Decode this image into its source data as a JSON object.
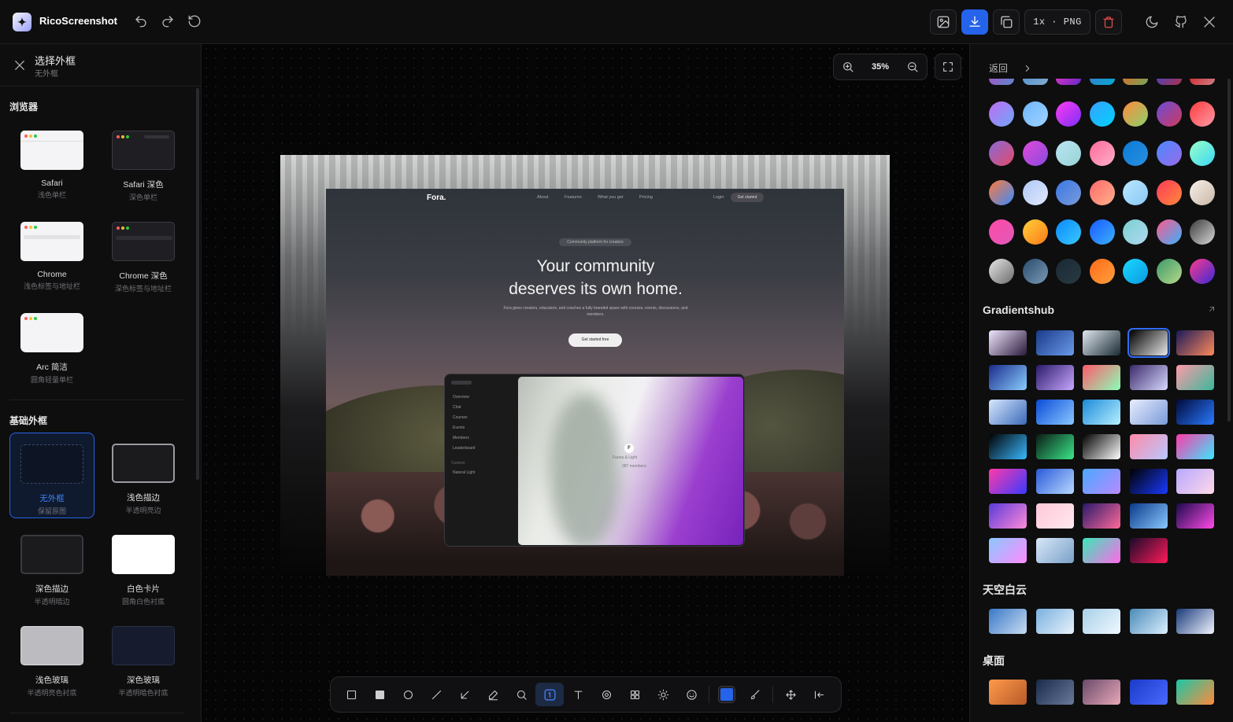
{
  "app": {
    "name": "RicoScreenshot",
    "format_label": "1x · PNG"
  },
  "colors": {
    "accent": "#2563eb",
    "danger": "#e04b4b",
    "background": "#0b0b0c"
  },
  "topbar": {
    "left_icons": [
      "undo-icon",
      "redo-icon",
      "reset-icon"
    ],
    "right_icons": [
      "image-icon",
      "download-icon",
      "copy-icon",
      "trash-icon",
      "moon-icon",
      "github-icon",
      "x-icon"
    ]
  },
  "left_panel": {
    "title": "选择外框",
    "subtitle": "无外框",
    "sections": [
      {
        "title": "浏览器",
        "items": [
          {
            "name": "Safari",
            "sub": "浅色单栏"
          },
          {
            "name": "Safari 深色",
            "sub": "深色单栏"
          },
          {
            "name": "Chrome",
            "sub": "浅色标签与地址栏"
          },
          {
            "name": "Chrome 深色",
            "sub": "深色标签与地址栏"
          },
          {
            "name": "Arc 简洁",
            "sub": "圆角轻量单栏"
          }
        ]
      },
      {
        "title": "基础外框",
        "items": [
          {
            "name": "无外框",
            "sub": "保留原图",
            "selected": true
          },
          {
            "name": "浅色描边",
            "sub": "半透明亮边"
          },
          {
            "name": "深色描边",
            "sub": "半透明暗边"
          },
          {
            "name": "白色卡片",
            "sub": "圆角白色衬底"
          },
          {
            "name": "浅色玻璃",
            "sub": "半透明亮色衬底"
          },
          {
            "name": "深色玻璃",
            "sub": "半透明暗色衬底"
          }
        ]
      }
    ]
  },
  "canvas": {
    "zoom": "35%",
    "preview": {
      "brand": "Fora.",
      "nav": [
        "About",
        "Features",
        "What you get",
        "Pricing"
      ],
      "login": "Login",
      "get_started": "Get started",
      "pill": "Community platform for creators",
      "headline_1": "Your community",
      "headline_2": "deserves its own home.",
      "subtext": "Fora gives creators, educators, and coaches a fully branded space with courses, events, discussions, and members.",
      "cta": "Get started free",
      "sidebar": [
        "Overview",
        "Chat",
        "Courses",
        "Events",
        "Members",
        "Leaderboard"
      ],
      "sidebar_section": "Content",
      "sidebar_extra": "Natural Light",
      "badge": "F",
      "card_title": "Fauna & Light",
      "card_meta": "387 members"
    }
  },
  "toolbar": {
    "tools": [
      "rect-outline-icon",
      "rect-filled-icon",
      "circle-icon",
      "line-icon",
      "arrow-icon",
      "pen-icon",
      "magnifier-icon",
      "number-icon",
      "text-icon",
      "blur-icon",
      "mosaic-icon",
      "brightness-icon",
      "emoji-icon"
    ],
    "active_tool": "number-icon",
    "current_color": "#2563eb"
  },
  "right_panel": {
    "back_label": "返回",
    "sections": {
      "gradientshub": "Gradientshub",
      "sky": "天空白云",
      "desktop": "桌面"
    },
    "swatches": [
      [
        "#c06cf3,#6fa8f7",
        "#6fb6ff,#9fd3ff",
        "#ff3cf2,#7b2ff7",
        "#3aa0ff,#00d2ff",
        "#ff8a3c,#8bd06a",
        "#6a4cd8,#d03a5c",
        "#ff3c3c,#ff9aa8"
      ],
      [
        "#8a6ad8,#e24a6a",
        "#e04ad8,#8a4ae0",
        "#b8e4f4,#9ad4d4",
        "#ff6a9a,#ffb0c8",
        "#0a7ad8,#2a90e0",
        "#4a8aff,#9a6ae8",
        "#9affc8,#3ad8f4"
      ],
      [
        "#ff7a3a,#3a8aff",
        "#b0c8f4,#e0e8ff",
        "#3a78e8,#7a9ad8",
        "#ff6a6a,#ffb08a",
        "#b8e8ff,#8ac8f4",
        "#ff3a5a,#ff8a3a",
        "#f8f0e8,#c8b8a8"
      ],
      [
        "#ff4aa8,#e05ab8",
        "#ffd03a,#ff7a1a",
        "#0a8aff,#3ac8ff",
        "#1a5aff,#3ab0ff",
        "#7ad0d0,#b0d8f0",
        "#ff5a8a,#3ab0ff",
        "#3a3a3a,#d8d8d8"
      ],
      [
        "#e8e8e8,#6a6a6a",
        "#2a4a6a,#7a9ab8",
        "#1a2a34,#2a3a44",
        "#ff6a1a,#ffa03a",
        "#1ad8ff,#0a9ae0",
        "#3a9a6a,#b8d88a",
        "#ff3a8a,#3a2ad8"
      ]
    ],
    "tiles_gradientshub": [
      "#f0e6ff,#2a1a3a",
      "#1a3a8a,#6a9ae8",
      "#e0e8ee,#1a2a34",
      "#000000,#e8e8e8",
      "#1a1a5a,#ff8a5a",
      "#1a2a8a,#8acfff",
      "#2a1a6a,#c8a8ff",
      "#ff5a6a,#8affb8",
      "#3a2a6a,#d8d8ff",
      "#ff9aa8,#3ab89a",
      "#d8e8ff,#3a6ab8",
      "#0a4ad8,#8ac8ff",
      "#1a8ad8,#b8f0ff",
      "#e8eeff,#7a9ad8",
      "#000a3a,#2a7aff",
      "#000000,#3ab8ff",
      "#0a1a14,#3ae88a",
      "#000000,#ffffff",
      "#ff8aa8,#b8c8ff",
      "#ff3aa8,#3ae8ff",
      "#ff3aa8,#3a3aff",
      "#2a5ad8,#b8d8ff",
      "#4aa8ff,#b88aff",
      "#000000,#1a3aff",
      "#b8a8ff,#ffd8e8",
      "#5a3ad8,#ff8ad8",
      "#ffc8d8,#ffe8ee",
      "#2a1a6a,#ff6a9a",
      "#0a3a8a,#8ac8ff",
      "#1a0a4a,#ff4ae8",
      "#8ac8ff,#ff8aff",
      "#d8e8f8,#7aa0c8",
      "#3ae8b8,#ff6ae8",
      "#1a0a2a,#ff1a5a"
    ],
    "tiles_sky": [
      "#3a78c8,#c8dcf0",
      "#7ab0e0,#e8f2fa",
      "#a8d0e8,#f0f8ff",
      "#4a8ab8,#dcefff",
      "#1a3a7a,#f0f4ff"
    ],
    "tiles_desktop": [
      "#ff9a4a,#b85a2a",
      "#1a2a4a,#6a7a9a",
      "#6a4a6a,#e8a8b8",
      "#1a3ac8,#4a6aff",
      "#1ac8a8,#ff8a3a"
    ]
  }
}
